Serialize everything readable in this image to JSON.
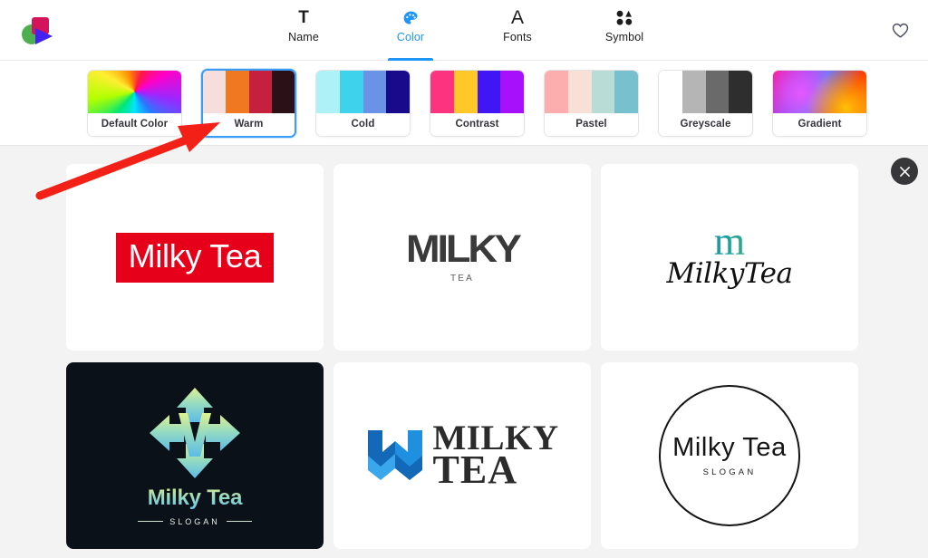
{
  "header": {
    "logo_icon": "app-logo-shapes-icon",
    "tabs": [
      {
        "label": "Name",
        "icon": "text-t-icon",
        "active": false
      },
      {
        "label": "Color",
        "icon": "color-palette-icon",
        "active": true
      },
      {
        "label": "Fonts",
        "icon": "font-a-icon",
        "active": false
      },
      {
        "label": "Symbol",
        "icon": "symbol-shapes-icon",
        "active": false
      }
    ],
    "favorite_icon": "heart-outline-icon",
    "active_accent": "#1f95f5"
  },
  "palettes": {
    "selected": "Warm",
    "items": [
      {
        "name": "Default Color",
        "type": "conic",
        "colors": [
          "#00e676",
          "#ffee33",
          "#ff3d00",
          "#ff00c8",
          "#7b2ff7",
          "#00b0ff",
          "#00e676"
        ]
      },
      {
        "name": "Warm",
        "type": "bars",
        "colors": [
          "#f6dedd",
          "#f07820",
          "#c6203f",
          "#2b1018"
        ]
      },
      {
        "name": "Cold",
        "type": "bars",
        "colors": [
          "#aef2f7",
          "#3ed2ec",
          "#6a93e8",
          "#170b8c"
        ]
      },
      {
        "name": "Contrast",
        "type": "bars",
        "colors": [
          "#fd337f",
          "#ffc828",
          "#4116f5",
          "#a610fb"
        ]
      },
      {
        "name": "Pastel",
        "type": "bars",
        "colors": [
          "#fcaeae",
          "#f8e0d6",
          "#b8ddd6",
          "#79c0cf"
        ]
      },
      {
        "name": "Greyscale",
        "type": "bars",
        "colors": [
          "#ffffff",
          "#b5b5b5",
          "#6a6a6a",
          "#2e2e2e"
        ]
      },
      {
        "name": "Gradient",
        "type": "linear",
        "colors": [
          "#ff1493",
          "#8b4cf0",
          "#7b6cf6",
          "#ff2d00",
          "#ffb300"
        ]
      }
    ]
  },
  "main": {
    "close_icon": "close-x-icon",
    "annotation": {
      "type": "arrow",
      "color": "#f22016",
      "points_to": "Warm"
    },
    "logos": [
      {
        "id": "logo-badge-red",
        "brand": "Milky Tea",
        "style": "white sans-serif on red rectangle",
        "bg": "#ffffff",
        "accent": "#e60019"
      },
      {
        "id": "logo-stacked-milky-tea",
        "brand_top": "MILKY",
        "brand_bottom": "TEA",
        "style": "bold condensed dark grey",
        "bg": "#ffffff",
        "accent": "#3a3a3a"
      },
      {
        "id": "logo-script-m",
        "monogram": "m",
        "brand_script": "Milky",
        "brand_italic": "Tea",
        "style": "gradient serif monogram over script wordmark",
        "bg": "#ffffff",
        "accent": "#17a3a0"
      },
      {
        "id": "logo-arrow-m-dark",
        "brand": "Milky Tea",
        "slogan": "SLOGAN",
        "style": "gradient arrow diamond M on dark background",
        "bg": "#0b1119",
        "accent": "#8fd6c8"
      },
      {
        "id": "logo-chevron-serif",
        "brand_top": "MILKY",
        "brand_bottom": "TEA",
        "style": "blue chevron mark with serif wordmark",
        "bg": "#ffffff",
        "accent": "#1b7fd4"
      },
      {
        "id": "logo-circle-thin",
        "brand": "Milky Tea",
        "slogan": "SLOGAN",
        "style": "thin sans-serif inside circle outline",
        "bg": "#ffffff",
        "accent": "#141414"
      }
    ]
  }
}
